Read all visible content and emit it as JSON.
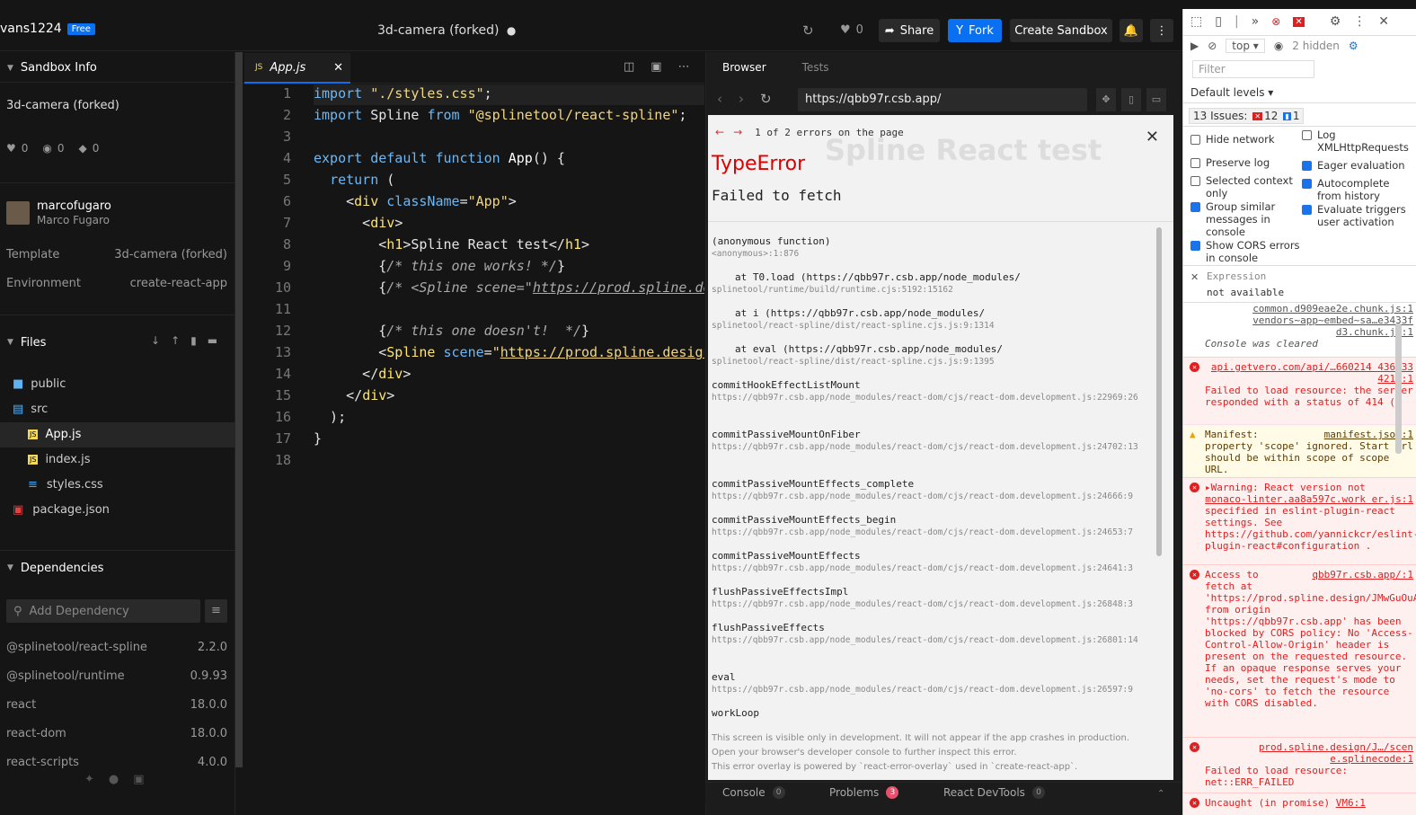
{
  "header": {
    "username": "vans1224",
    "plan_badge": "Free",
    "sandbox_title": "3d-camera (forked)",
    "likes": "0",
    "share_label": "Share",
    "fork_label": "Fork",
    "create_label": "Create Sandbox"
  },
  "sidebar": {
    "info_heading": "Sandbox Info",
    "sandbox_name": "3d-camera (forked)",
    "stats": {
      "likes": "0",
      "views": "0",
      "forks": "0"
    },
    "author_handle": "marcofugaro",
    "author_name": "Marco Fugaro",
    "template_label": "Template",
    "template_value": "3d-camera (forked)",
    "environment_label": "Environment",
    "environment_value": "create-react-app",
    "files_heading": "Files",
    "files": [
      {
        "name": "public",
        "type": "folder"
      },
      {
        "name": "src",
        "type": "folder-open"
      },
      {
        "name": "App.js",
        "type": "js"
      },
      {
        "name": "index.js",
        "type": "js"
      },
      {
        "name": "styles.css",
        "type": "css"
      },
      {
        "name": "package.json",
        "type": "json"
      }
    ],
    "deps_heading": "Dependencies",
    "add_dep_placeholder": "Add Dependency",
    "deps": [
      {
        "name": "@splinetool/react-spline",
        "version": "2.2.0"
      },
      {
        "name": "@splinetool/runtime",
        "version": "0.9.93"
      },
      {
        "name": "react",
        "version": "18.0.0"
      },
      {
        "name": "react-dom",
        "version": "18.0.0"
      },
      {
        "name": "react-scripts",
        "version": "4.0.0"
      }
    ]
  },
  "editor": {
    "tab_label": "App.js",
    "tab_prefix": "JS",
    "line_numbers": [
      "1",
      "2",
      "3",
      "4",
      "5",
      "6",
      "7",
      "8",
      "9",
      "10",
      "11",
      "12",
      "13",
      "14",
      "15",
      "16",
      "17",
      "18"
    ]
  },
  "browser": {
    "tab_browser": "Browser",
    "tab_tests": "Tests",
    "url": "https://qbb97r.csb.app/",
    "page_heading_ghost": "Spline React test",
    "error_counter": "1 of 2 errors on the page",
    "error_type": "TypeError",
    "error_message": "Failed to fetch",
    "frames": [
      {
        "fn": "(anonymous function)",
        "loc": "<anonymous>:1:876"
      },
      {
        "fn": "at T0.load (https://qbb97r.csb.app/node_modules/",
        "loc": "splinetool/runtime/build/runtime.cjs:5192:15162"
      },
      {
        "fn": "at i (https://qbb97r.csb.app/node_modules/",
        "loc": "splinetool/react-spline/dist/react-spline.cjs.js:9:1314"
      },
      {
        "fn": "at eval (https://qbb97r.csb.app/node_modules/",
        "loc": "splinetool/react-spline/dist/react-spline.cjs.js:9:1395"
      },
      {
        "fn": "commitHookEffectListMount",
        "loc": "https://qbb97r.csb.app/node_modules/react-dom/cjs/react-dom.development.js:22969:26"
      },
      {
        "fn": "commitPassiveMountOnFiber",
        "loc": "https://qbb97r.csb.app/node_modules/react-dom/cjs/react-dom.development.js:24702:13"
      },
      {
        "fn": "commitPassiveMountEffects_complete",
        "loc": "https://qbb97r.csb.app/node_modules/react-dom/cjs/react-dom.development.js:24666:9"
      },
      {
        "fn": "commitPassiveMountEffects_begin",
        "loc": "https://qbb97r.csb.app/node_modules/react-dom/cjs/react-dom.development.js:24653:7"
      },
      {
        "fn": "commitPassiveMountEffects",
        "loc": "https://qbb97r.csb.app/node_modules/react-dom/cjs/react-dom.development.js:24641:3"
      },
      {
        "fn": "flushPassiveEffectsImpl",
        "loc": "https://qbb97r.csb.app/node_modules/react-dom/cjs/react-dom.development.js:26848:3"
      },
      {
        "fn": "flushPassiveEffects",
        "loc": "https://qbb97r.csb.app/node_modules/react-dom/cjs/react-dom.development.js:26801:14"
      },
      {
        "fn": "eval",
        "loc": "https://qbb97r.csb.app/node_modules/react-dom/cjs/react-dom.development.js:26597:9"
      },
      {
        "fn": "workLoop",
        "loc": ""
      }
    ],
    "footer_notes": [
      "This screen is visible only in development. It will not appear if the app crashes in production.",
      "Open your browser's developer console to further inspect this error.",
      "This error overlay is powered by `react-error-overlay` used in `create-react-app`."
    ]
  },
  "bottom_tabs": [
    {
      "label": "Console",
      "count": "0"
    },
    {
      "label": "Problems",
      "count": "3"
    },
    {
      "label": "React DevTools",
      "count": "0"
    }
  ],
  "devtools": {
    "context": "top",
    "hidden": "2 hidden",
    "filter_placeholder": "Filter",
    "levels": "Default levels",
    "issues_label": "13 Issues:",
    "issues_errors": "12",
    "issues_info": "1",
    "settings": [
      {
        "label": "Hide network",
        "checked": false
      },
      {
        "label": "Log XMLHttpRequests",
        "checked": false
      },
      {
        "label": "Preserve log",
        "checked": false
      },
      {
        "label": "Eager evaluation",
        "checked": true
      },
      {
        "label": "Selected context only",
        "checked": false
      },
      {
        "label": "Autocomplete from history",
        "checked": true
      },
      {
        "label": "Group similar messages in console",
        "checked": true
      },
      {
        "label": "Evaluate triggers user activation",
        "checked": true
      },
      {
        "label": "Show CORS errors in console",
        "checked": true
      }
    ],
    "expression_label": "Expression",
    "expression_value": "not available",
    "messages": {
      "m0a": "common.d909eae2e.chunk.js:1",
      "m0b": "vendors~app~embed~sa…e3433f",
      "m0c": "d3.chunk.js:1",
      "m0d": "Console was cleared",
      "m1link": "api.getvero.com/api/…660214 436333 4216:1",
      "m1text": "Failed to load resource: the server responded with a status of 414 ()",
      "m2label": "Manifest:",
      "m2link": "manifest.json:1",
      "m2text": "property 'scope' ignored. Start url should be within scope of scope URL.",
      "m3a": "▸Warning: React version not",
      "m3link": "monaco-linter.aa8a597c.work er.js:1",
      "m3text": "specified in eslint-plugin-react settings. See https://github.com/yannickcr/eslint-plugin-react#configuration .",
      "m4a": "Access to",
      "m4link": "qbb97r.csb.app/:1",
      "m4text": "fetch at 'https://prod.spline.design/JMwGuOuABb5gBWR1/scene.splinecode' from origin 'https://qbb97r.csb.app' has been blocked by CORS policy: No 'Access-Control-Allow-Origin' header is present on the requested resource. If an opaque response serves your needs, set the request's mode to 'no-cors' to fetch the resource with CORS disabled.",
      "m5link": "prod.spline.design/J…/scen e.splinecode:1",
      "m5text": "Failed to load resource: net::ERR_FAILED",
      "m6a": "Uncaught (in promise)",
      "m6link": "VM6:1"
    }
  }
}
